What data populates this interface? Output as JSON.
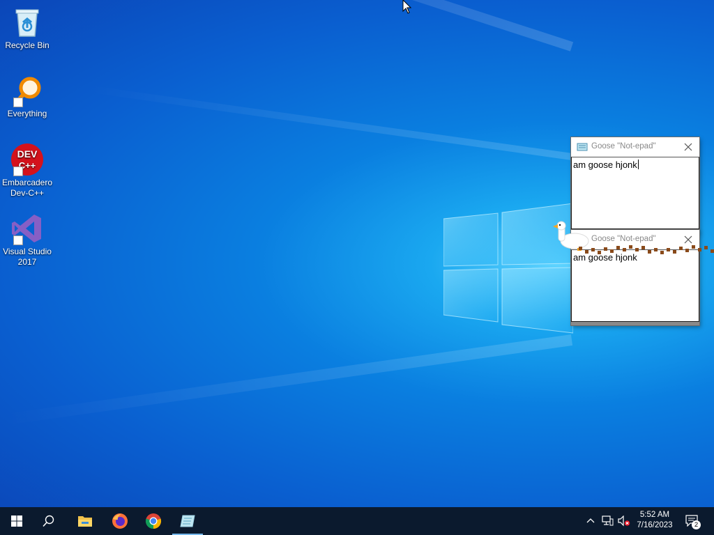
{
  "desktop": {
    "icons": [
      {
        "label": "Recycle Bin",
        "icon": "recycle-bin-icon"
      },
      {
        "label": "Everything",
        "icon": "everything-search-icon"
      },
      {
        "label": "Embarcadero Dev-C++",
        "icon": "devcpp-icon",
        "glyph": "DEV C++"
      },
      {
        "label": "Visual Studio 2017",
        "icon": "visual-studio-icon"
      }
    ]
  },
  "windows": [
    {
      "title": "Goose \"Not-epad\"",
      "text": "am goose hjonk"
    },
    {
      "title": "Goose \"Not-epad\"",
      "text": "am goose hjonk"
    }
  ],
  "taskbar": {
    "items": [
      {
        "name": "start",
        "icon": "windows-logo-icon"
      },
      {
        "name": "search",
        "icon": "search-icon"
      },
      {
        "name": "file-explorer",
        "icon": "folder-icon"
      },
      {
        "name": "firefox",
        "icon": "firefox-icon"
      },
      {
        "name": "chrome",
        "icon": "chrome-icon"
      },
      {
        "name": "notepad",
        "icon": "notepad-icon"
      }
    ],
    "tray": {
      "time": "5:52 AM",
      "date": "7/16/2023",
      "notification_count": "2"
    }
  },
  "colors": {
    "taskbar": "#0b1a2e",
    "accent": "#76b9ed",
    "trail": "#8a4a1a"
  }
}
